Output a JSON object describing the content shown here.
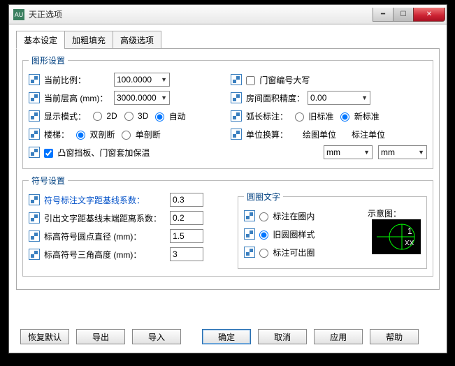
{
  "window": {
    "title": "天正选项"
  },
  "tabs": [
    {
      "label": "基本设定",
      "active": true
    },
    {
      "label": "加粗填充",
      "active": false
    },
    {
      "label": "高级选项",
      "active": false
    }
  ],
  "graphics": {
    "legend": "图形设置",
    "scale_label": "当前比例：",
    "scale_value": "100.0000",
    "floor_height_label": "当前层高 (mm)：",
    "floor_height_value": "3000.0000",
    "display_mode_label": "显示模式：",
    "display_modes": {
      "d2": "2D",
      "d3": "3D",
      "auto": "自动",
      "selected": "auto"
    },
    "stair_label": "楼梯：",
    "stair": {
      "double": "双剖断",
      "single": "单剖断",
      "selected": "double"
    },
    "insulation_label": "凸窗挡板、门窗套加保温",
    "insulation_checked": true,
    "window_upper_label": "门窗编号大写",
    "window_upper_checked": false,
    "area_precision_label": "房间面积精度：",
    "area_precision_value": "0.00",
    "arc_label": "弧长标注：",
    "arc": {
      "old": "旧标准",
      "new": "新标准",
      "selected": "new"
    },
    "unit_label": "单位换算：",
    "unit_draw_label": "绘图单位",
    "unit_anno_label": "标注单位",
    "unit_draw_value": "mm",
    "unit_anno_value": "mm"
  },
  "symbols": {
    "legend": "符号设置",
    "text_offset_label": "符号标注文字距基线系数：",
    "text_offset_value": "0.3",
    "leader_end_label": "引出文字距基线末端距离系数：",
    "leader_end_value": "0.2",
    "elev_diameter_label": "标高符号圆点直径 (mm)：",
    "elev_diameter_value": "1.5",
    "elev_triangle_label": "标高符号三角高度 (mm)：",
    "elev_triangle_value": "3",
    "circle_legend": "圆圈文字",
    "circle_inside": "标注在圈内",
    "circle_old": "旧圆圈样式",
    "circle_out": "标注可出圈",
    "circle_selected": "old",
    "sample_label": "示意图："
  },
  "buttons": {
    "restore": "恢复默认",
    "export": "导出",
    "import": "导入",
    "ok": "确定",
    "cancel": "取消",
    "apply": "应用",
    "help": "帮助"
  }
}
